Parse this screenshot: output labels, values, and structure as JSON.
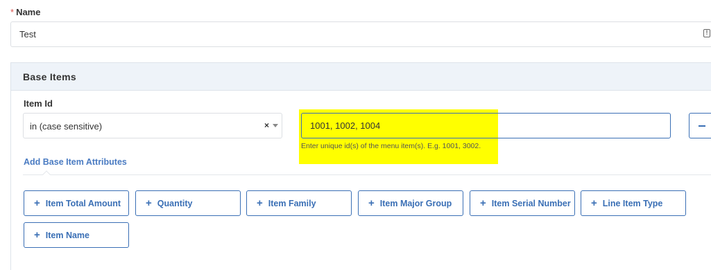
{
  "name_field": {
    "required_marker": "*",
    "label": "Name",
    "value": "Test"
  },
  "base_items": {
    "title": "Base Items",
    "item_id": {
      "label": "Item Id",
      "operator": "in (case sensitive)",
      "clear_symbol": "×",
      "value": "1001, 1002, 1004",
      "help": "Enter unique id(s) of the menu item(s). E.g. 1001, 3002."
    },
    "add_attributes_label": "Add Base Item Attributes",
    "attribute_buttons": [
      {
        "label": "Item Total Amount"
      },
      {
        "label": "Quantity"
      },
      {
        "label": "Item Family"
      },
      {
        "label": "Item Major Group"
      },
      {
        "label": "Item Serial Number"
      },
      {
        "label": "Line Item Type"
      },
      {
        "label": "Item Name"
      }
    ]
  },
  "colors": {
    "accent": "#3a6fb5",
    "highlight": "#ffff00",
    "panel_header": "#eef3f9",
    "required": "#d9534f"
  },
  "icons": {
    "plus": "+",
    "remove": "minus-icon",
    "dropdown": "chevron-down-icon",
    "field_icon": "info-icon"
  }
}
